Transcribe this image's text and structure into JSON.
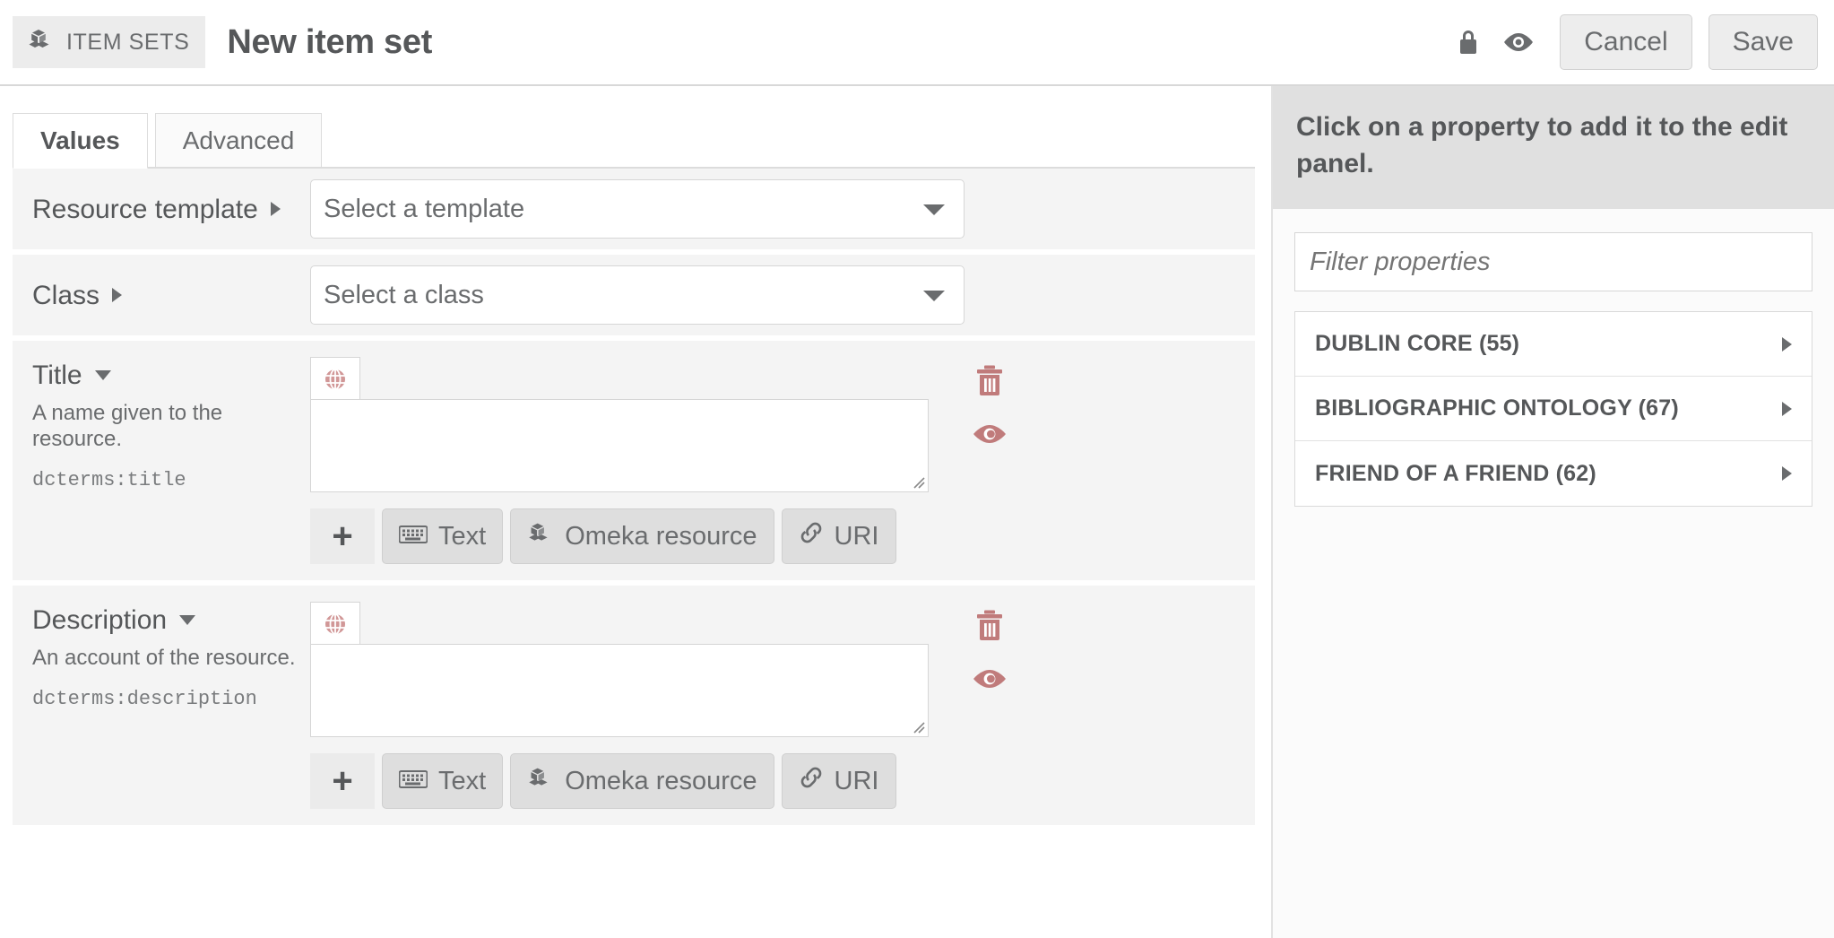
{
  "topbar": {
    "breadcrumb_label": "ITEM SETS",
    "breadcrumb_icon": "item-sets-cubes-icon",
    "page_title": "New item set",
    "lock_icon": "lock-icon",
    "preview_icon": "eye-icon",
    "cancel_label": "Cancel",
    "save_label": "Save"
  },
  "tabs": [
    {
      "label": "Values",
      "active": true
    },
    {
      "label": "Advanced",
      "active": false
    }
  ],
  "fields": {
    "resource_template": {
      "label": "Resource template",
      "select_value": "Select a template"
    },
    "class": {
      "label": "Class",
      "select_value": "Select a class"
    }
  },
  "properties": [
    {
      "label": "Title",
      "description": "A name given to the resource.",
      "qname": "dcterms:title",
      "lang_icon": "globe-icon",
      "value": "",
      "delete_icon": "trash-icon",
      "visibility_icon": "eye-icon",
      "add_label": "+",
      "types": [
        {
          "label": "Text",
          "icon": "keyboard-icon"
        },
        {
          "label": "Omeka resource",
          "icon": "cubes-icon"
        },
        {
          "label": "URI",
          "icon": "link-icon"
        }
      ]
    },
    {
      "label": "Description",
      "description": "An account of the resource.",
      "qname": "dcterms:description",
      "lang_icon": "globe-icon",
      "value": "",
      "delete_icon": "trash-icon",
      "visibility_icon": "eye-icon",
      "add_label": "+",
      "types": [
        {
          "label": "Text",
          "icon": "keyboard-icon"
        },
        {
          "label": "Omeka resource",
          "icon": "cubes-icon"
        },
        {
          "label": "URI",
          "icon": "link-icon"
        }
      ]
    }
  ],
  "sidebar": {
    "heading": "Click on a property to add it to the edit panel.",
    "filter_placeholder": "Filter properties",
    "filter_value": "",
    "vocabularies": [
      {
        "name": "DUBLIN CORE (55)"
      },
      {
        "name": "BIBLIOGRAPHIC ONTOLOGY (67)"
      },
      {
        "name": "FRIEND OF A FRIEND (62)"
      }
    ]
  },
  "colors": {
    "accent_rose": "#c98b8b",
    "text": "#555759",
    "panel_bg": "#f4f4f4",
    "sidebar_head_bg": "#e0e0e0"
  }
}
